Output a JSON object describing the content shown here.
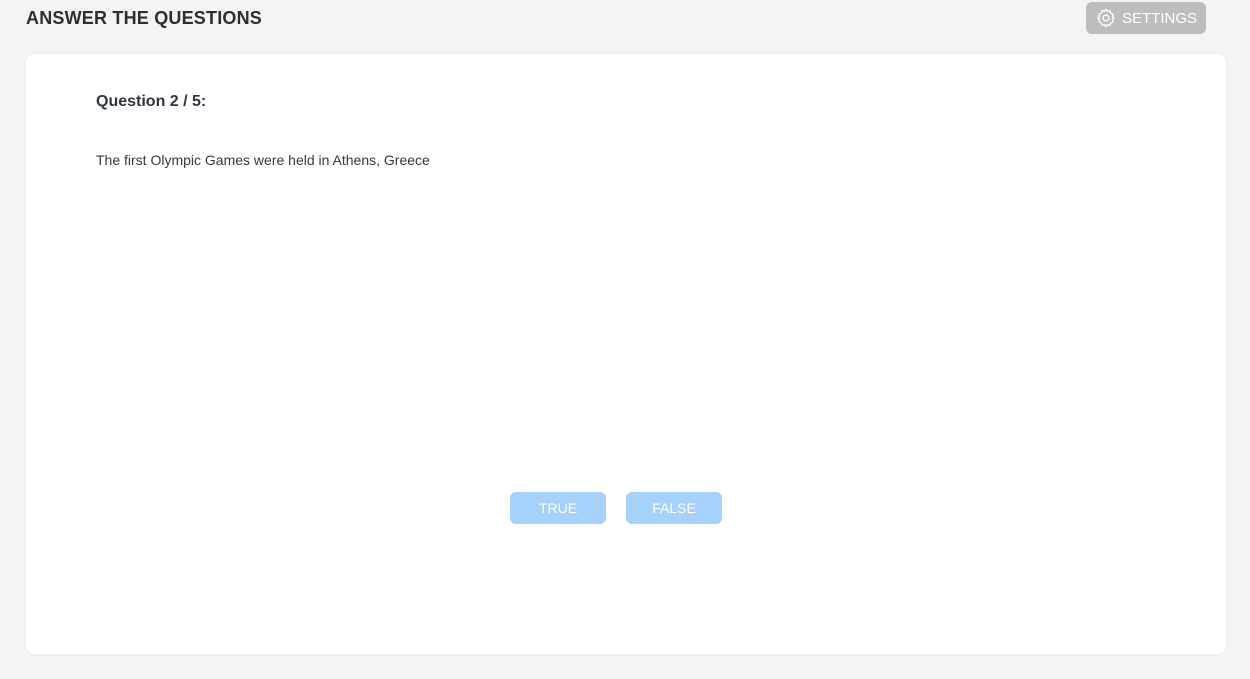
{
  "header": {
    "title": "ANSWER THE QUESTIONS",
    "settings_label": "SETTINGS",
    "settings_icon": "gear-icon"
  },
  "quiz": {
    "question_number": "Question 2 / 5:",
    "question_text": "The first Olympic Games were held in Athens, Greece",
    "answers": {
      "true_label": "TRUE",
      "false_label": "FALSE"
    }
  },
  "colors": {
    "background": "#f4f4f4",
    "card": "#ffffff",
    "settings_button": "#bdbdbd",
    "answer_button": "#a6d1fb"
  }
}
